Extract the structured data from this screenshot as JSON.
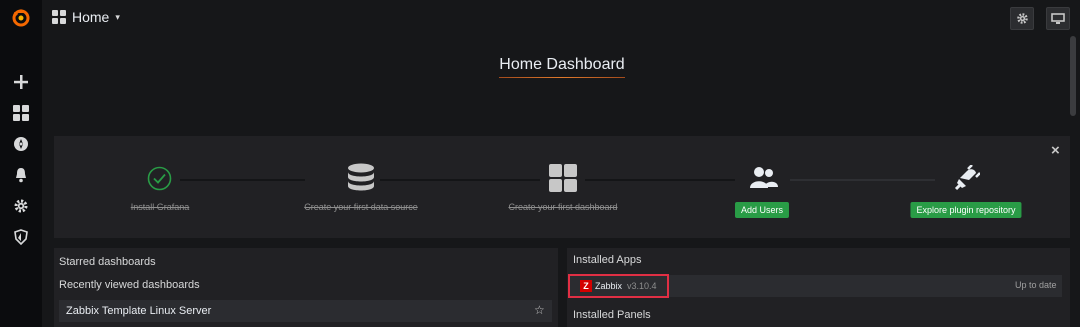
{
  "topbar": {
    "title": "Home",
    "caret": "▾",
    "settings_icon": "gear-icon",
    "tv_icon": "monitor-icon"
  },
  "sidebar": {
    "items": [
      "grafana-logo",
      "plus-icon",
      "dashboards-icon",
      "explore-icon",
      "alerting-bell-icon",
      "configuration-gear-icon",
      "shield-icon"
    ]
  },
  "home_dashboard": {
    "title": "Home Dashboard"
  },
  "getting_started": {
    "steps": [
      {
        "label": "Install Grafana",
        "done": true,
        "icon": "check-circle-icon"
      },
      {
        "label": "Create your first data source",
        "done": true,
        "icon": "database-icon"
      },
      {
        "label": "Create your first dashboard",
        "done": true,
        "icon": "dashboard-grid-icon"
      },
      {
        "label": "Add Users",
        "done": false,
        "icon": "users-icon"
      },
      {
        "label": "Explore plugin repository",
        "done": false,
        "icon": "plug-icon"
      }
    ],
    "close": "×"
  },
  "starred": {
    "title": "Starred dashboards",
    "recent_title": "Recently viewed dashboards",
    "recent": [
      {
        "name": "Zabbix Template Linux Server"
      }
    ]
  },
  "apps": {
    "title": "Installed Apps",
    "items": [
      {
        "badge": "Z",
        "name": "Zabbix",
        "version": "v3.10.4",
        "status": "Up to date"
      }
    ],
    "panels_title": "Installed Panels"
  },
  "colors": {
    "accent": "#eb7b18",
    "success": "#299c46",
    "highlight": "#e02f44",
    "zabbix": "#d40000"
  }
}
